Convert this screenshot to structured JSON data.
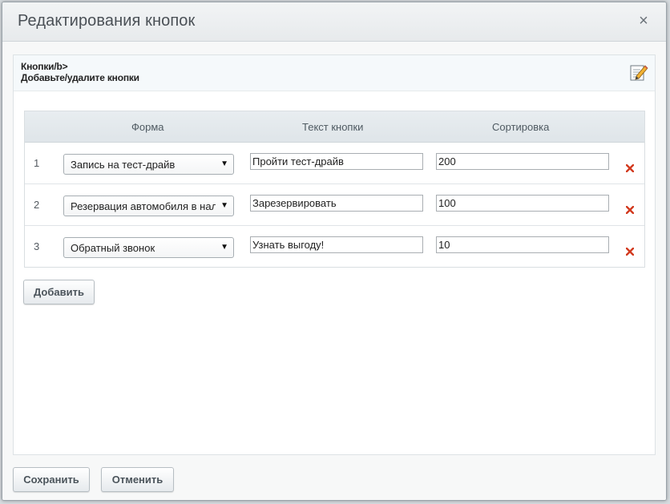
{
  "dialog": {
    "title": "Редактирования кнопок",
    "close_icon": "close-icon"
  },
  "panel": {
    "line1": "Кнопки/b>",
    "line2": "Добавьте/удалите кнопки",
    "edit_icon": "edit-pencil-icon"
  },
  "table": {
    "headers": {
      "form": "Форма",
      "button_text": "Текст кнопки",
      "sort": "Сортировка"
    },
    "rows": [
      {
        "num": "1",
        "form": "Запись на тест-драйв",
        "button_text": "Пройти тест-драйв",
        "sort": "200"
      },
      {
        "num": "2",
        "form": "Резервация автомобиля в наличии",
        "button_text": "Зарезервировать",
        "sort": "100"
      },
      {
        "num": "3",
        "form": "Обратный звонок",
        "button_text": "Узнать выгоду!",
        "sort": "10"
      }
    ]
  },
  "buttons": {
    "add": "Добавить",
    "save": "Сохранить",
    "cancel": "Отменить"
  },
  "colors": {
    "delete_icon": "#d23a1f",
    "header_bg": "#e8edf0"
  }
}
